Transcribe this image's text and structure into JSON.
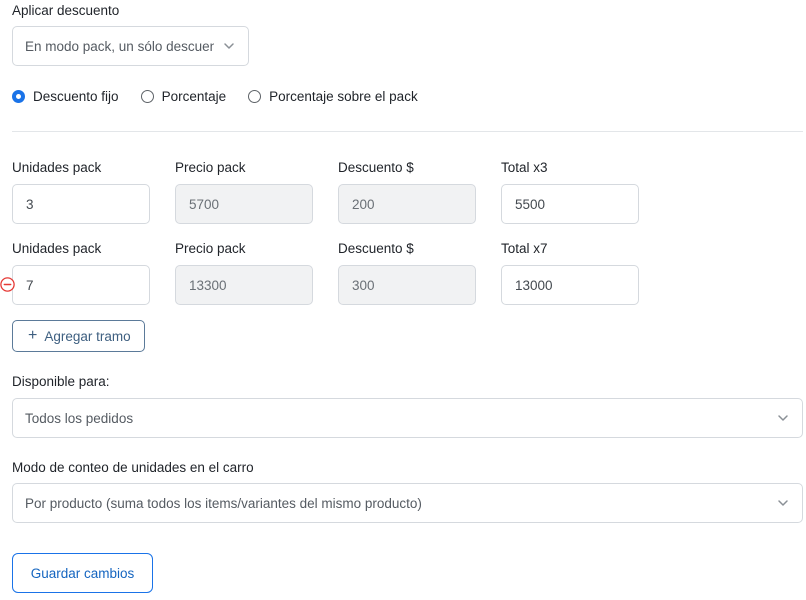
{
  "discount": {
    "label": "Aplicar descuento",
    "mode_value": "En modo pack, un sólo descuento",
    "options": [
      {
        "label": "Descuento fijo",
        "checked": true
      },
      {
        "label": "Porcentaje",
        "checked": false
      },
      {
        "label": "Porcentaje sobre el pack",
        "checked": false
      }
    ]
  },
  "tiers": [
    {
      "units_label": "Unidades pack",
      "units": "3",
      "price_label": "Precio pack",
      "price": "5700",
      "discount_label": "Descuento $",
      "discount": "200",
      "total_label": "Total x3",
      "total": "5500"
    },
    {
      "units_label": "Unidades pack",
      "units": "7",
      "price_label": "Precio pack",
      "price": "13300",
      "discount_label": "Descuento $",
      "discount": "300",
      "total_label": "Total x7",
      "total": "13000"
    }
  ],
  "add_tier_label": "Agregar tramo",
  "available": {
    "label": "Disponible para:",
    "value": "Todos los pedidos"
  },
  "count_mode": {
    "label": "Modo de conteo de unidades en el carro",
    "value": "Por producto (suma todos los items/variantes del mismo producto)"
  },
  "save_label": "Guardar cambios",
  "colors": {
    "accent": "#1a73e8",
    "remove": "#e53935",
    "secondary_button": "#3e5f80"
  },
  "icons": {
    "chevron": "chevron-down-icon",
    "remove": "minus-circle-icon",
    "add": "plus-icon"
  }
}
